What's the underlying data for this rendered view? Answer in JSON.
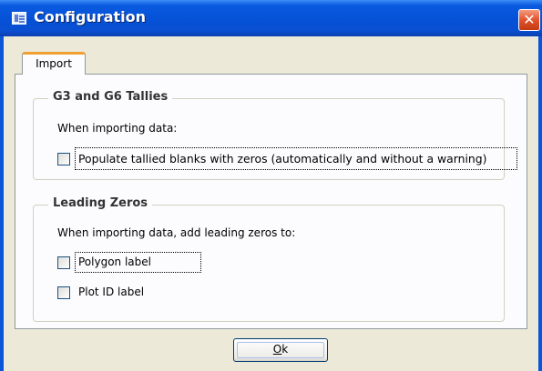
{
  "window": {
    "title": "Configuration",
    "icon": "form-icon",
    "close_symbol": "✕"
  },
  "tabs": [
    {
      "label": "Import",
      "selected": true
    }
  ],
  "g3_group": {
    "title": "G3 and G6 Tallies",
    "instruction": "When importing data:",
    "checkbox": {
      "label": "Populate tallied blanks with zeros (automatically and without a warning)",
      "checked": false
    }
  },
  "leading_group": {
    "title": "Leading Zeros",
    "instruction": "When importing data, add leading zeros to:",
    "polygon_checkbox": {
      "label": "Polygon label",
      "checked": false
    },
    "plot_checkbox": {
      "label": "Plot ID label",
      "checked": false
    }
  },
  "buttons": {
    "ok_prefix": "O",
    "ok_rest": "k"
  }
}
